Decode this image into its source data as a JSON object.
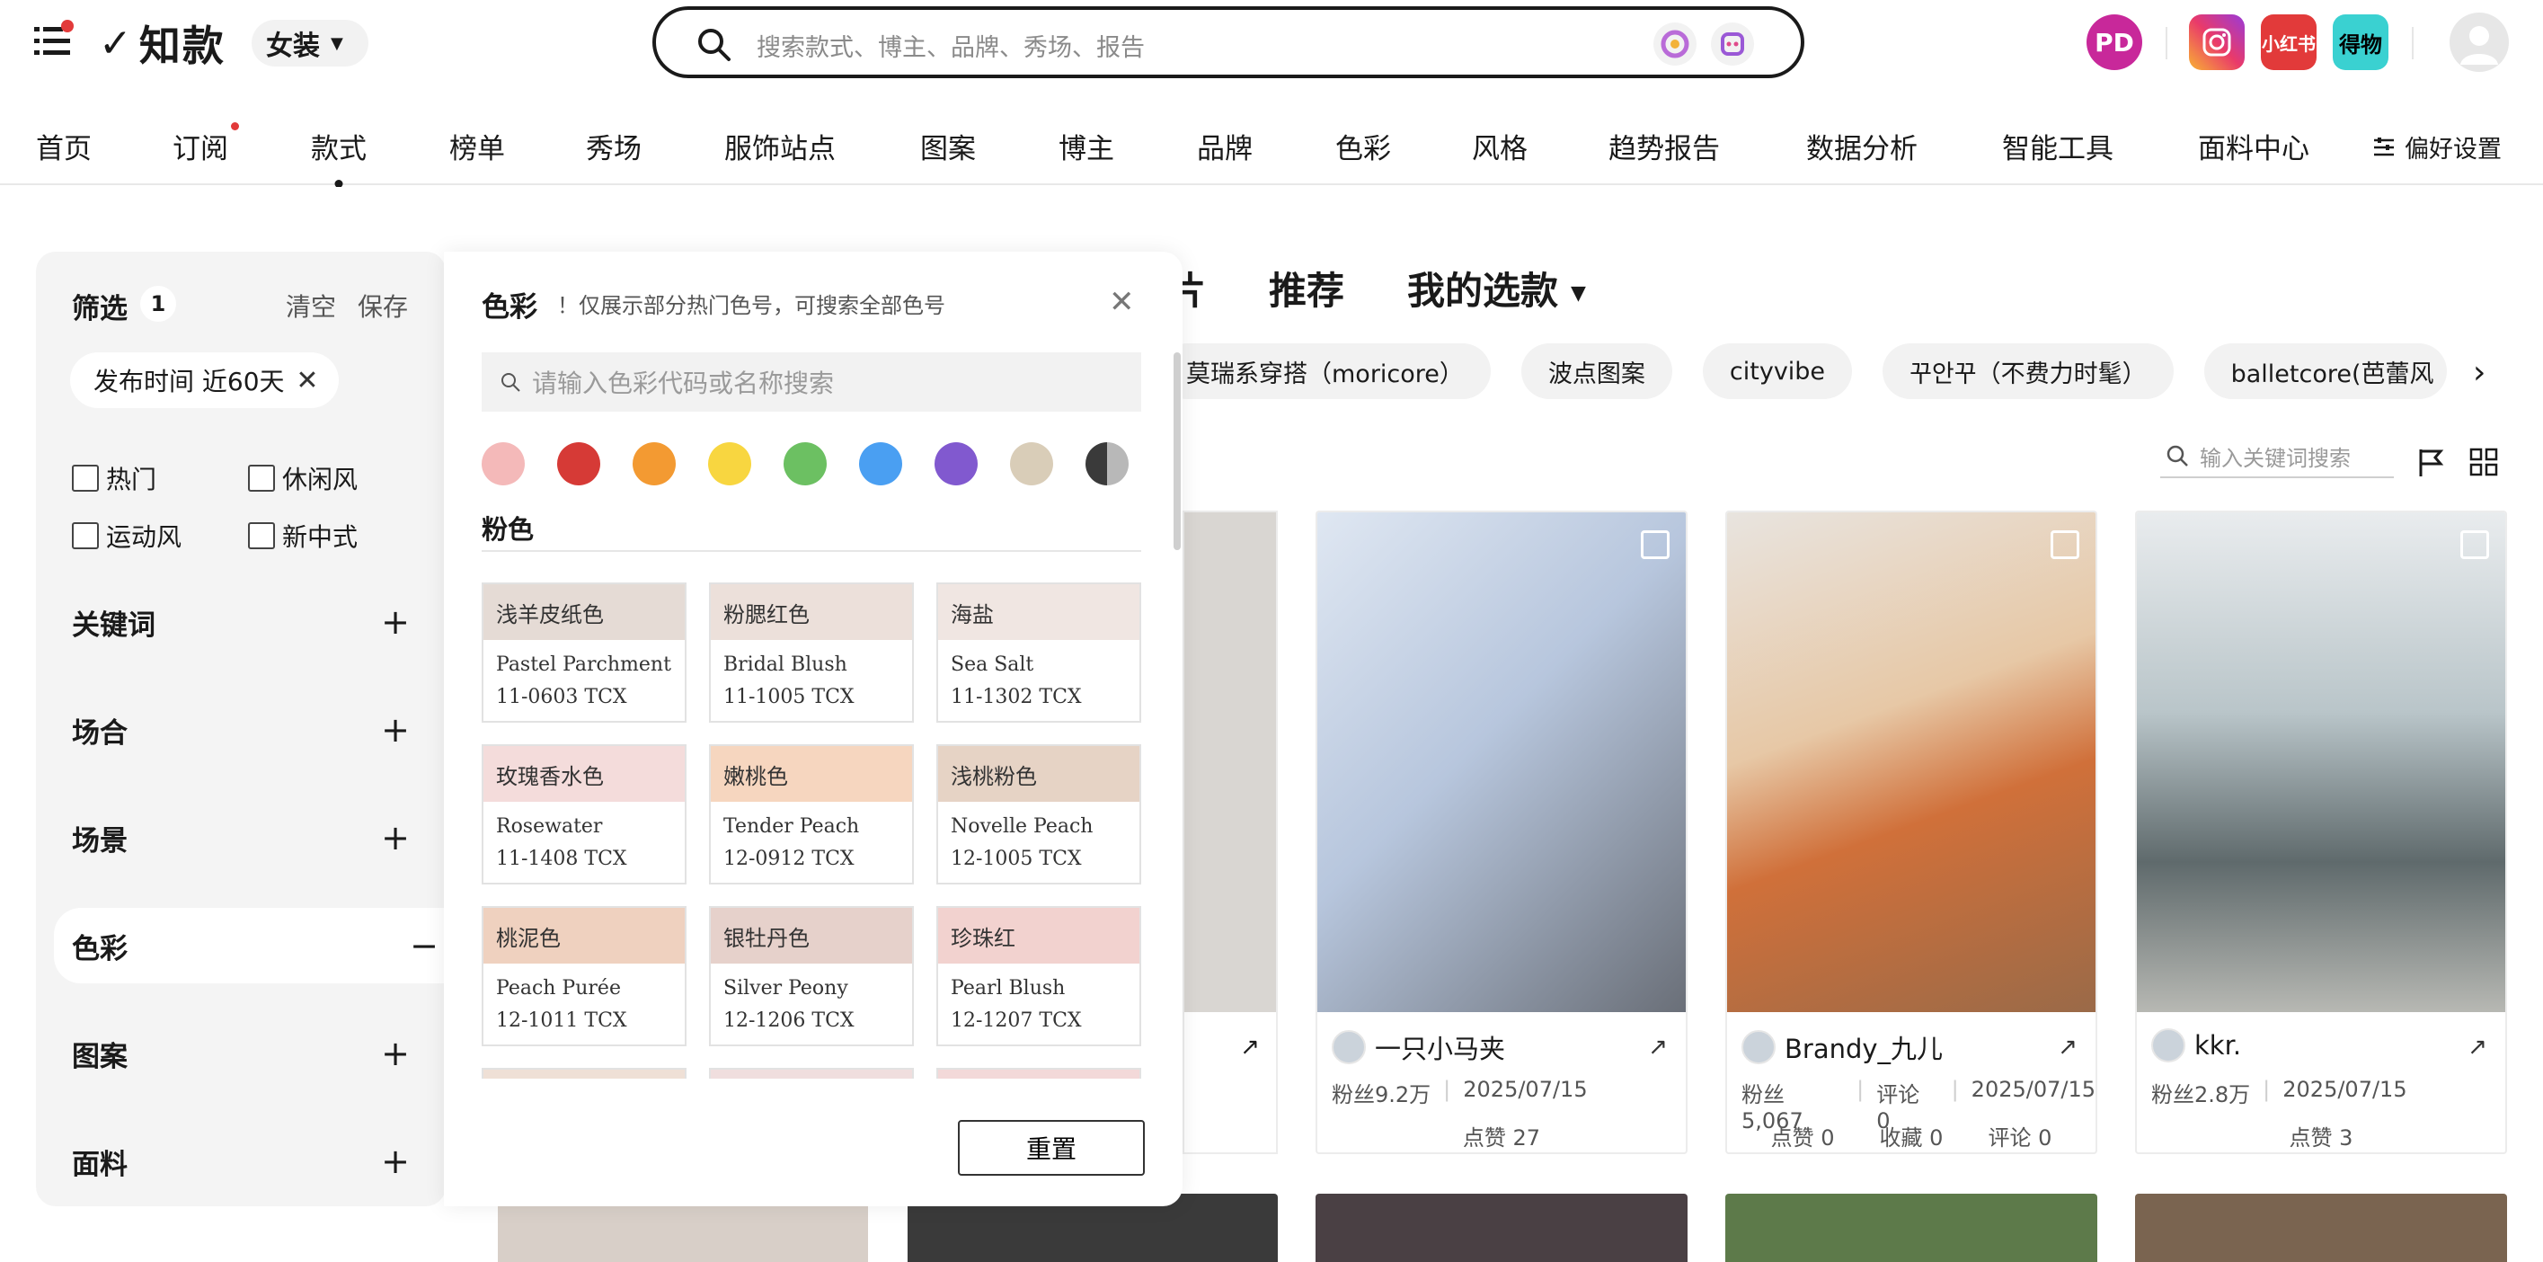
{
  "header": {
    "logo_text": "知款",
    "category": "女装",
    "search_placeholder": "搜索款式、博主、品牌、秀场、报告",
    "social": {
      "xhs": "小红书",
      "dw": "得物"
    }
  },
  "nav": {
    "items": [
      "首页",
      "订阅",
      "款式",
      "榜单",
      "秀场",
      "服饰站点",
      "图案",
      "博主",
      "品牌",
      "色彩",
      "风格",
      "趋势报告",
      "数据分析",
      "智能工具",
      "面料中心"
    ],
    "pref": "偏好设置"
  },
  "filter": {
    "title": "筛选",
    "count": "1",
    "clear": "清空",
    "save": "保存",
    "active_tag": "发布时间 近60天",
    "checkboxes": [
      "热门",
      "休闲风",
      "运动风",
      "新中式"
    ],
    "sections": [
      "关键词",
      "场合",
      "场景",
      "色彩",
      "图案",
      "面料"
    ]
  },
  "color_panel": {
    "title": "色彩",
    "note": "！仅展示部分热门色号，可搜索全部色号",
    "search_placeholder": "请输入色彩代码或名称搜索",
    "swatches": [
      "#f4b9b9",
      "#d63a36",
      "#f39a32",
      "#f8d640",
      "#6cc062",
      "#4a9ff2",
      "#8159cf",
      "#d9cdb8",
      "#777777"
    ],
    "group": "粉色",
    "reset": "重置",
    "cards": [
      {
        "cn": "浅羊皮纸色",
        "en": "Pastel Parchment",
        "code": "11-0603 TCX",
        "color": "#e5dbd5"
      },
      {
        "cn": "粉腮红色",
        "en": "Bridal Blush",
        "code": "11-1005 TCX",
        "color": "#ece0da"
      },
      {
        "cn": "海盐",
        "en": "Sea Salt",
        "code": "11-1302 TCX",
        "color": "#f0e6e2"
      },
      {
        "cn": "玫瑰香水色",
        "en": "Rosewater",
        "code": "11-1408 TCX",
        "color": "#f4dcdb"
      },
      {
        "cn": "嫩桃色",
        "en": "Tender Peach",
        "code": "12-0912 TCX",
        "color": "#f6d6bf"
      },
      {
        "cn": "浅桃粉色",
        "en": "Novelle Peach",
        "code": "12-1005 TCX",
        "color": "#e6d3c5"
      },
      {
        "cn": "桃泥色",
        "en": "Peach Purée",
        "code": "12-1011 TCX",
        "color": "#efd1bf"
      },
      {
        "cn": "银牡丹色",
        "en": "Silver Peony",
        "code": "12-1206 TCX",
        "color": "#e6d1cb"
      },
      {
        "cn": "珍珠红",
        "en": "Pearl Blush",
        "code": "12-1207 TCX",
        "color": "#f2d2cf"
      }
    ]
  },
  "main": {
    "tabs": [
      "片",
      "推荐",
      "我的选款"
    ],
    "chips": [
      "莫瑞系穿搭（moricore）",
      "波点图案",
      "cityvibe",
      "꾸안꾸（不费力时髦）",
      "balletcore(芭蕾风"
    ],
    "kw_placeholder": "输入关键词搜索",
    "cards": [
      {
        "user": "一只小马夹",
        "fans": "粉丝9.2万",
        "date": "2025/07/15",
        "stats": [
          "点赞 27"
        ],
        "img": "#c5d1e4"
      },
      {
        "user": "Brandy_九儿",
        "fans": "粉丝5,067",
        "comment": "评论 0",
        "date": "2025/07/15",
        "stats": [
          "点赞 0",
          "收藏 0",
          "评论 0"
        ],
        "img": "#d8b79a"
      },
      {
        "user": "kkr.",
        "fans": "粉丝2.8万",
        "date": "2025/07/15",
        "stats": [
          "点赞 3"
        ],
        "img": "#9fa6a8"
      }
    ]
  }
}
